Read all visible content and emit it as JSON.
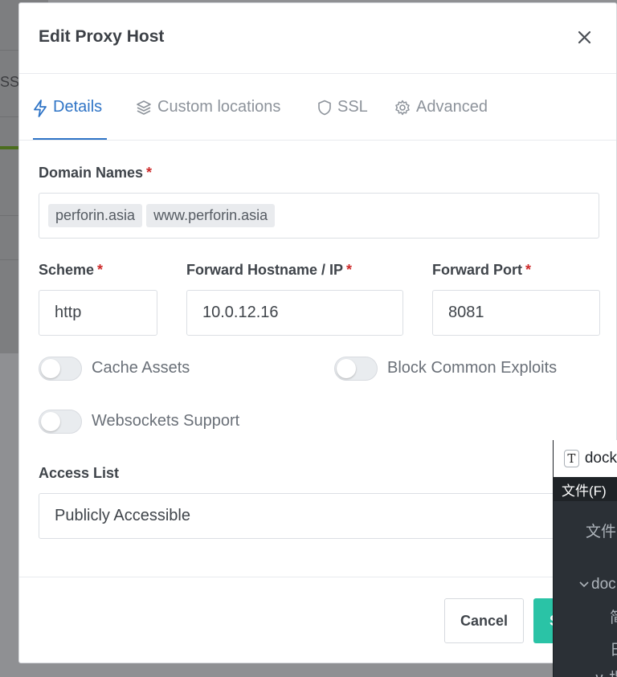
{
  "background": {
    "partial_text": "SSL"
  },
  "modal": {
    "title": "Edit Proxy Host",
    "tabs": [
      {
        "label": "Details",
        "icon": "bolt-icon",
        "active": true
      },
      {
        "label": "Custom locations",
        "icon": "layers-icon",
        "active": false
      },
      {
        "label": "SSL",
        "icon": "shield-icon",
        "active": false
      },
      {
        "label": "Advanced",
        "icon": "gear-icon",
        "active": false
      }
    ],
    "domain_names": {
      "label": "Domain Names",
      "required_mark": "*",
      "tags": [
        "perforin.asia",
        "www.perforin.asia"
      ]
    },
    "scheme": {
      "label": "Scheme",
      "required_mark": "*",
      "value": "http"
    },
    "forward_host": {
      "label": "Forward Hostname / IP",
      "required_mark": "*",
      "value": "10.0.12.16"
    },
    "forward_port": {
      "label": "Forward Port",
      "required_mark": "*",
      "value": "8081"
    },
    "toggles": {
      "cache_assets": {
        "label": "Cache Assets",
        "on": false
      },
      "block_exploits": {
        "label": "Block Common Exploits",
        "on": false
      },
      "websockets": {
        "label": "Websockets Support",
        "on": false
      }
    },
    "access_list": {
      "label": "Access List",
      "value": "Publicly Accessible"
    },
    "footer": {
      "cancel_label": "Cancel",
      "save_label": "Save"
    }
  },
  "file_manager": {
    "title_partial": "dock",
    "menu_partial": "文件(F)",
    "row_1_partial": "文件",
    "folder_partial": "doc",
    "child_1_partial": "简",
    "child_2_partial": "日",
    "child_3_partial": "∨ 指"
  },
  "colors": {
    "accent_blue": "#2f74c6",
    "required_red": "#cd2a2a",
    "save_teal": "#2ac3a6",
    "overlay_gray": "#8f9093",
    "file_manager_dark": "#2b3036"
  }
}
